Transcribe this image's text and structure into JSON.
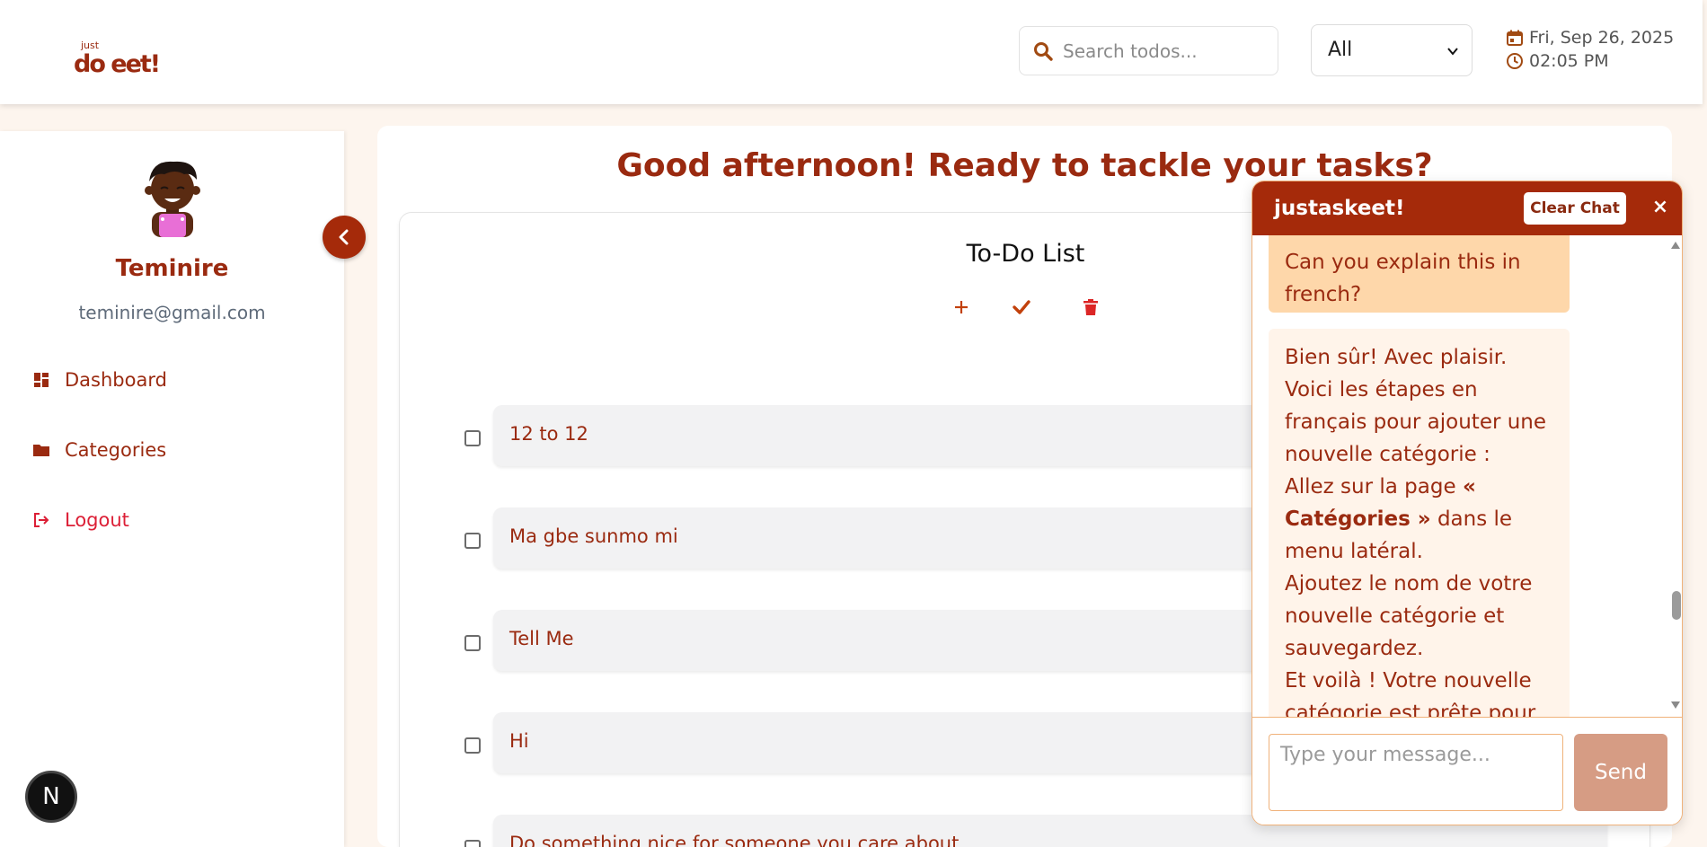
{
  "header": {
    "logo_small": "just",
    "logo_big": "do eet!",
    "search_placeholder": "Search todos...",
    "filter_value": "All",
    "date": "Fri, Sep 26, 2025",
    "time": "02:05 PM"
  },
  "sidebar": {
    "name": "Teminire",
    "email": "teminire@gmail.com",
    "items": [
      {
        "label": "Dashboard",
        "icon": "dashboard-icon"
      },
      {
        "label": "Categories",
        "icon": "folder-icon"
      },
      {
        "label": "Logout",
        "icon": "logout-icon"
      }
    ]
  },
  "main": {
    "greeting": "Good afternoon! Ready to tackle your tasks?",
    "list_title": "To-Do List",
    "todos": [
      "12 to 12",
      "Ma gbe sunmo mi",
      "Tell Me",
      "Hi",
      "Do something nice for someone you care about"
    ]
  },
  "chat": {
    "title": "justaskeet!",
    "clear_label": "Clear Chat",
    "close_label": "×",
    "user_message": "Can you explain this in french?",
    "bot_p1": "Bien sûr! Avec plaisir. Voici les étapes en français pour ajouter une nouvelle catégorie :",
    "bot_p2_pre": "Allez sur la page ",
    "bot_p2_bold": "« Catégories »",
    "bot_p2_post": " dans le menu latéral.",
    "bot_p3": "Ajoutez le nom de votre nouvelle catégorie et sauvegardez.",
    "bot_p4": "Et voilà ! Votre nouvelle catégorie est prête pour u",
    "input_placeholder": "Type your message...",
    "send_label": "Send"
  },
  "badge": {
    "label": "N"
  },
  "colors": {
    "brand": "#a52a0a",
    "text": "#9a2a10",
    "logout": "#dc1f36",
    "user_bubble": "#fed7aa",
    "bot_bubble": "#fff4ea"
  }
}
